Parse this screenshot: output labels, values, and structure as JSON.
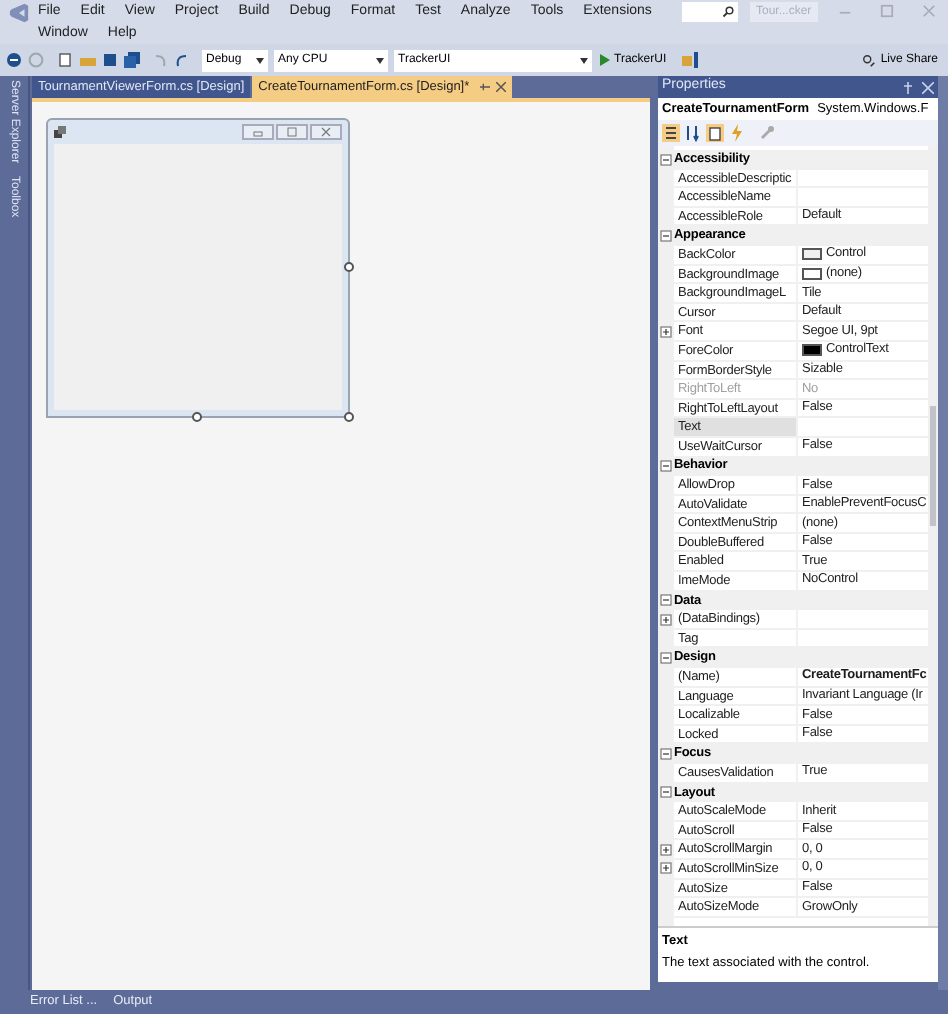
{
  "menu": [
    "File",
    "Edit",
    "View",
    "Project",
    "Build",
    "Debug",
    "Format",
    "Test",
    "Analyze",
    "Tools",
    "Extensions",
    "Window",
    "Help"
  ],
  "title_box": "Tour...cker",
  "toolbar": {
    "configuration": "Debug",
    "platform": "Any CPU",
    "startup_project": "TrackerUI",
    "run_button": "TrackerUI",
    "live_share": "Live Share"
  },
  "left_side_tabs": [
    "Server Explorer",
    "Toolbox"
  ],
  "document_tabs": [
    {
      "label": "TournamentViewerForm.cs [Design]",
      "selected": false
    },
    {
      "label": "CreateTournamentForm.cs [Design]*",
      "selected": true
    }
  ],
  "properties": {
    "title": "Properties",
    "object_name": "CreateTournamentForm",
    "object_type": "System.Windows.F",
    "categories": [
      {
        "name": "Accessibility",
        "expanded": true,
        "rows": [
          {
            "name": "AccessibleDescriptic",
            "value": "",
            "kind": "plain",
            "selected": false,
            "disabled": false
          },
          {
            "name": "AccessibleName",
            "value": "",
            "kind": "plain",
            "selected": false,
            "disabled": false
          },
          {
            "name": "AccessibleRole",
            "value": "Default",
            "kind": "plain",
            "selected": false,
            "disabled": false
          }
        ]
      },
      {
        "name": "Appearance",
        "expanded": true,
        "rows": [
          {
            "name": "BackColor",
            "value": "Control",
            "kind": "swatch",
            "color": "#f0f0f0",
            "selected": false,
            "disabled": false
          },
          {
            "name": "BackgroundImage",
            "value": "(none)",
            "kind": "swatch",
            "color": "#ffffff",
            "selected": false,
            "disabled": false
          },
          {
            "name": "BackgroundImageL",
            "value": "Tile",
            "kind": "plain",
            "selected": false,
            "disabled": false
          },
          {
            "name": "Cursor",
            "value": "Default",
            "kind": "plain",
            "selected": false,
            "disabled": false
          },
          {
            "name": "Font",
            "value": "Segoe UI, 9pt",
            "kind": "expandable",
            "selected": false,
            "disabled": false
          },
          {
            "name": "ForeColor",
            "value": "ControlText",
            "kind": "swatch",
            "color": "#000000",
            "selected": false,
            "disabled": false
          },
          {
            "name": "FormBorderStyle",
            "value": "Sizable",
            "kind": "plain",
            "selected": false,
            "disabled": false
          },
          {
            "name": "RightToLeft",
            "value": "No",
            "kind": "plain",
            "selected": false,
            "disabled": true
          },
          {
            "name": "RightToLeftLayout",
            "value": "False",
            "kind": "plain",
            "selected": false,
            "disabled": false
          },
          {
            "name": "Text",
            "value": "",
            "kind": "plain",
            "selected": true,
            "disabled": false
          },
          {
            "name": "UseWaitCursor",
            "value": "False",
            "kind": "plain",
            "selected": false,
            "disabled": false
          }
        ]
      },
      {
        "name": "Behavior",
        "expanded": true,
        "rows": [
          {
            "name": "AllowDrop",
            "value": "False",
            "kind": "plain",
            "selected": false,
            "disabled": false
          },
          {
            "name": "AutoValidate",
            "value": "EnablePreventFocusC",
            "kind": "plain",
            "selected": false,
            "disabled": false
          },
          {
            "name": "ContextMenuStrip",
            "value": "(none)",
            "kind": "plain",
            "selected": false,
            "disabled": false
          },
          {
            "name": "DoubleBuffered",
            "value": "False",
            "kind": "plain",
            "selected": false,
            "disabled": false
          },
          {
            "name": "Enabled",
            "value": "True",
            "kind": "plain",
            "selected": false,
            "disabled": false
          },
          {
            "name": "ImeMode",
            "value": "NoControl",
            "kind": "plain",
            "selected": false,
            "disabled": false
          }
        ]
      },
      {
        "name": "Data",
        "expanded": true,
        "rows": [
          {
            "name": "(DataBindings)",
            "value": "",
            "kind": "expandable",
            "selected": false,
            "disabled": false
          },
          {
            "name": "Tag",
            "value": "",
            "kind": "plain",
            "selected": false,
            "disabled": false
          }
        ]
      },
      {
        "name": "Design",
        "expanded": true,
        "rows": [
          {
            "name": "(Name)",
            "value": "CreateTournamentFc",
            "kind": "bold",
            "selected": false,
            "disabled": false
          },
          {
            "name": "Language",
            "value": "Invariant Language (Ir",
            "kind": "plain",
            "selected": false,
            "disabled": false
          },
          {
            "name": "Localizable",
            "value": "False",
            "kind": "plain",
            "selected": false,
            "disabled": false
          },
          {
            "name": "Locked",
            "value": "False",
            "kind": "plain",
            "selected": false,
            "disabled": false
          }
        ]
      },
      {
        "name": "Focus",
        "expanded": true,
        "rows": [
          {
            "name": "CausesValidation",
            "value": "True",
            "kind": "plain",
            "selected": false,
            "disabled": false
          }
        ]
      },
      {
        "name": "Layout",
        "expanded": true,
        "rows": [
          {
            "name": "AutoScaleMode",
            "value": "Inherit",
            "kind": "plain",
            "selected": false,
            "disabled": false
          },
          {
            "name": "AutoScroll",
            "value": "False",
            "kind": "plain",
            "selected": false,
            "disabled": false
          },
          {
            "name": "AutoScrollMargin",
            "value": "0, 0",
            "kind": "expandable",
            "selected": false,
            "disabled": false
          },
          {
            "name": "AutoScrollMinSize",
            "value": "0, 0",
            "kind": "expandable",
            "selected": false,
            "disabled": false
          },
          {
            "name": "AutoSize",
            "value": "False",
            "kind": "plain",
            "selected": false,
            "disabled": false
          },
          {
            "name": "AutoSizeMode",
            "value": "GrowOnly",
            "kind": "plain",
            "selected": false,
            "disabled": false
          }
        ]
      }
    ],
    "description": {
      "title": "Text",
      "text": "The text associated with the control."
    }
  },
  "bottom_tabs": [
    "Error List ...",
    "Output"
  ]
}
